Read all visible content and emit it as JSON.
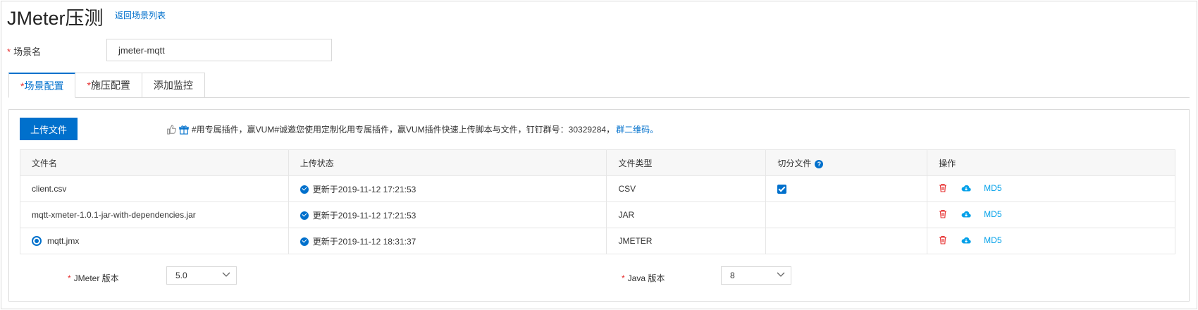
{
  "header": {
    "title": "JMeter压测",
    "back_link": "返回场景列表"
  },
  "scene_name": {
    "label": "场景名",
    "required_mark": "*",
    "value": "jmeter-mqtt"
  },
  "tabs": [
    {
      "req": "*",
      "label": "场景配置",
      "active": true
    },
    {
      "req": "*",
      "label": "施压配置",
      "active": false
    },
    {
      "req": "",
      "label": "添加监控",
      "active": false
    }
  ],
  "toolbar": {
    "upload_label": "上传文件",
    "notice_text": "#用专属插件，赢VUM#诚邀您使用定制化用专属插件，赢VUM插件快速上传脚本与文件，钉钉群号：30329284，",
    "notice_link": "群二维码。"
  },
  "table": {
    "columns": {
      "name": "文件名",
      "status": "上传状态",
      "type": "文件类型",
      "split": "切分文件",
      "ops": "操作"
    },
    "help_symbol": "?",
    "rows": [
      {
        "name": "client.csv",
        "status": "更新于2019-11-12 17:21:53",
        "type": "CSV",
        "split": true,
        "selected": false,
        "md5": "MD5"
      },
      {
        "name": "mqtt-xmeter-1.0.1-jar-with-dependencies.jar",
        "status": "更新于2019-11-12 17:21:53",
        "type": "JAR",
        "split": false,
        "selected": false,
        "md5": "MD5"
      },
      {
        "name": "mqtt.jmx",
        "status": "更新于2019-11-12 18:31:37",
        "type": "JMETER",
        "split": false,
        "selected": true,
        "md5": "MD5"
      }
    ]
  },
  "versions": {
    "jmeter": {
      "req": "*",
      "label": "JMeter 版本",
      "value": "5.0"
    },
    "java": {
      "req": "*",
      "label": "Java 版本",
      "value": "8"
    }
  },
  "colors": {
    "accent": "#0070cc",
    "required": "#e62e2e",
    "delete": "#e62e2e",
    "cloud": "#00a0e9"
  },
  "icons": [
    "thumbs-up-icon",
    "gift-icon",
    "help-icon",
    "check-circle-icon",
    "checkbox-icon",
    "radio-icon",
    "trash-icon",
    "cloud-download-icon",
    "chevron-down-icon"
  ]
}
